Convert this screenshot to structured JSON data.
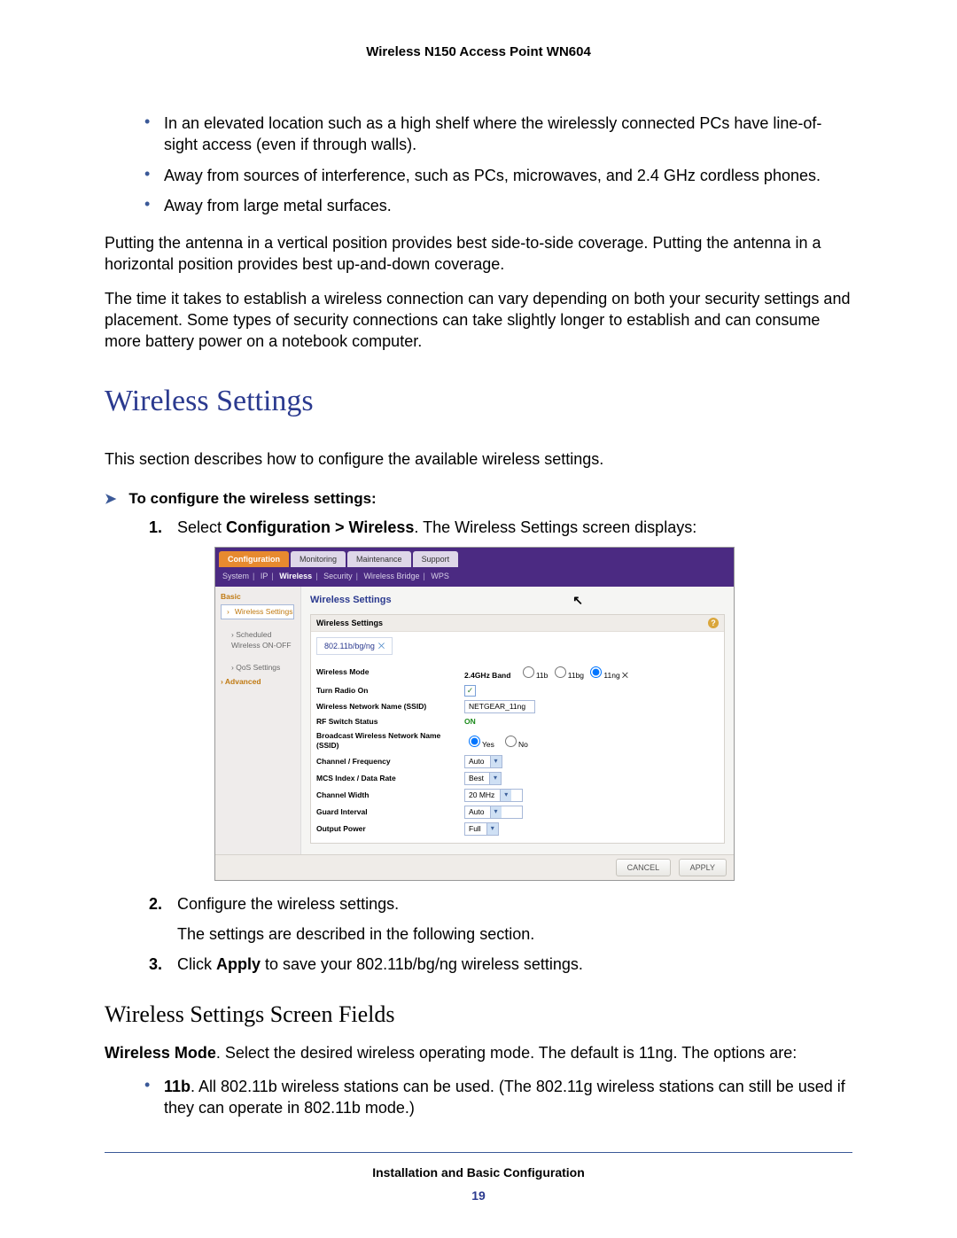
{
  "doc": {
    "header": "Wireless N150 Access Point WN604",
    "bullets": [
      "In an elevated location such as a high shelf where the wirelessly connected PCs have line-of-sight access (even if through walls).",
      "Away from sources of interference, such as PCs, microwaves, and 2.4 GHz cordless phones.",
      "Away from large metal surfaces."
    ],
    "para1": "Putting the antenna in a vertical position provides best side-to-side coverage. Putting the antenna in a horizontal position provides best up-and-down coverage.",
    "para2": "The time it takes to establish a wireless connection can vary depending on both your security settings and placement. Some types of security connections can take slightly longer to establish and can consume more battery power on a notebook computer.",
    "h1": "Wireless Settings",
    "intro": "This section describes how to configure the available wireless settings.",
    "proc_head": "To configure the wireless settings:",
    "step1_pre": "Select ",
    "step1_bold": "Configuration > Wireless",
    "step1_post": ". The Wireless Settings screen displays:",
    "step2": "Configure the wireless settings.",
    "step2_sub": "The settings are described in the following section.",
    "step3_pre": "Click ",
    "step3_bold": "Apply",
    "step3_post": " to save your 802.11b/bg/ng wireless settings.",
    "h2": "Wireless Settings Screen Fields",
    "wm_label": "Wireless Mode",
    "wm_text": ". Select the desired wireless operating mode. The default is 11ng. The options are:",
    "opt11b_label": "11b",
    "opt11b_text": ". All 802.11b wireless stations can be used. (The 802.11g wireless stations can still be used if they can operate in 802.11b mode.)",
    "footer_title": "Installation and Basic Configuration",
    "page_number": "19"
  },
  "admin": {
    "tabs": [
      "Configuration",
      "Monitoring",
      "Maintenance",
      "Support"
    ],
    "subnav": [
      "System",
      "IP",
      "Wireless",
      "Security",
      "Wireless Bridge",
      "WPS"
    ],
    "subnav_active": "Wireless",
    "sidebar": {
      "top": "Basic",
      "items": [
        "Wireless Settings",
        "Scheduled Wireless ON-OFF",
        "QoS Settings",
        "Advanced"
      ],
      "selected": "Wireless Settings"
    },
    "panel_title": "Wireless Settings",
    "group_title": "Wireless Settings",
    "mode_box": "802.11b/bg/ng",
    "rows": {
      "wireless_mode": {
        "label": "Wireless Mode",
        "band": "2.4GHz Band",
        "opts": [
          "11b",
          "11bg",
          "11ng"
        ],
        "selected": "11ng"
      },
      "turn_radio": {
        "label": "Turn Radio On",
        "checked": true
      },
      "ssid": {
        "label": "Wireless Network Name (SSID)",
        "value": "NETGEAR_11ng"
      },
      "rf": {
        "label": "RF Switch Status",
        "value": "ON"
      },
      "broadcast": {
        "label": "Broadcast Wireless Network Name (SSID)",
        "opts": [
          "Yes",
          "No"
        ],
        "selected": "Yes"
      },
      "channel": {
        "label": "Channel / Frequency",
        "value": "Auto"
      },
      "mcs": {
        "label": "MCS Index / Data Rate",
        "value": "Best"
      },
      "width": {
        "label": "Channel Width",
        "value": "20 MHz"
      },
      "guard": {
        "label": "Guard Interval",
        "value": "Auto"
      },
      "power": {
        "label": "Output Power",
        "value": "Full"
      }
    },
    "buttons": {
      "cancel": "CANCEL",
      "apply": "APPLY"
    }
  }
}
